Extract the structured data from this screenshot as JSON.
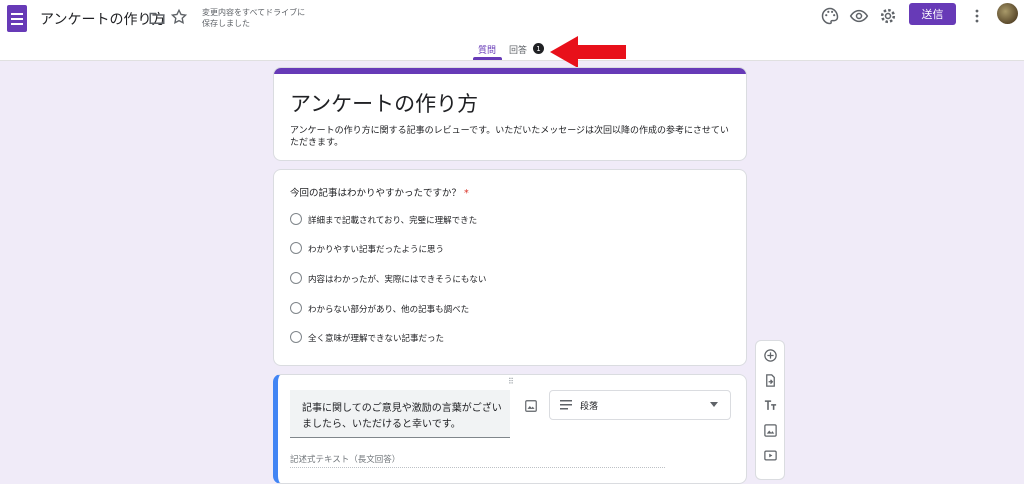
{
  "header": {
    "doc_title": "アンケートの作り方",
    "save_status_line1": "変更内容をすべてドライブに",
    "save_status_line2": "保存しました",
    "send_label": "送信"
  },
  "tabs": [
    {
      "label": "質問",
      "active": true
    },
    {
      "label": "回答",
      "active": false,
      "badge": "1"
    }
  ],
  "form": {
    "title": "アンケートの作り方",
    "description": "アンケートの作り方に関する記事のレビューです。いただいたメッセージは次回以降の作成の参考にさせていただきます。"
  },
  "question1": {
    "title": "今回の記事はわかりやすかったですか？",
    "required_mark": "*",
    "options": [
      "詳細まで記載されており、完璧に理解できた",
      "わかりやすい記事だったように思う",
      "内容はわかったが、実際にはできそうにもない",
      "わからない部分があり、他の記事も調べた",
      "全く意味が理解できない記事だった"
    ]
  },
  "question2": {
    "title": "記事に関してのご意見や激励の言葉がございましたら、いただけると幸いです。",
    "type_label": "段落",
    "answer_placeholder": "記述式テキスト（長文回答）"
  },
  "colors": {
    "accent": "#673ab7",
    "background": "#f0ebf8",
    "annotation_arrow": "#e8101a",
    "active_card_border": "#4285f4"
  },
  "icons": [
    "forms-app-icon",
    "folder-icon",
    "star-icon",
    "palette-icon",
    "preview-eye-icon",
    "settings-gear-icon",
    "more-vert-icon",
    "add-question-icon",
    "import-questions-icon",
    "add-title-icon",
    "add-image-icon",
    "add-video-icon"
  ]
}
